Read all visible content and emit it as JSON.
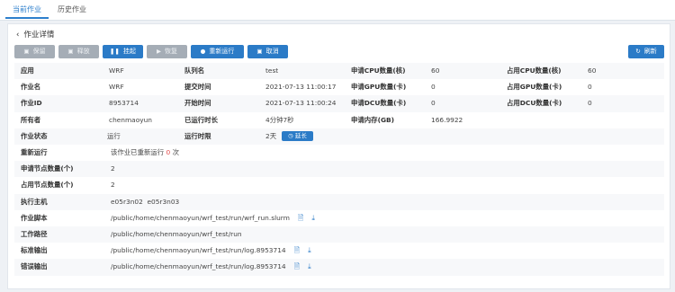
{
  "tabs": [
    {
      "label": "当前作业",
      "active": true
    },
    {
      "label": "历史作业",
      "active": false
    }
  ],
  "header": {
    "back_label": "作业详情"
  },
  "toolbar": {
    "hold": "保留",
    "release": "释放",
    "suspend": "挂起",
    "resume": "恢复",
    "rerun": "重新运行",
    "cancel": "取消",
    "refresh": "刷新"
  },
  "detail": {
    "app_label": "应用",
    "app": "WRF",
    "queue_label": "队列名",
    "queue": "test",
    "req_cpu_label": "申请CPU数量(核)",
    "req_cpu": "60",
    "used_cpu_label": "占用CPU数量(核)",
    "used_cpu": "60",
    "job_name_label": "作业名",
    "job_name": "WRF",
    "submit_time_label": "提交时间",
    "submit_time": "2021-07-13 11:00:17",
    "req_gpu_label": "申请GPU数量(卡)",
    "req_gpu": "0",
    "used_gpu_label": "占用GPU数量(卡)",
    "used_gpu": "0",
    "job_id_label": "作业ID",
    "job_id": "8953714",
    "start_time_label": "开始时间",
    "start_time": "2021-07-13 11:00:24",
    "req_dcu_label": "申请DCU数量(卡)",
    "req_dcu": "0",
    "used_dcu_label": "占用DCU数量(卡)",
    "used_dcu": "0",
    "owner_label": "所有者",
    "owner": "chenmaoyun",
    "elapsed_label": "已运行时长",
    "elapsed": "4分钟7秒",
    "req_mem_label": "申请内存(GB)",
    "req_mem": "166.9922",
    "status_label": "作业状态",
    "status": "运行",
    "limit_label": "运行时限",
    "limit": "2天",
    "extend_label": "延长",
    "rerun_label": "重新运行",
    "rerun_prefix": "该作业已重新运行",
    "rerun_count": "0",
    "rerun_suffix": "次",
    "req_nodes_label": "申请节点数量(个)",
    "req_nodes": "2",
    "used_nodes_label": "占用节点数量(个)",
    "used_nodes": "2",
    "hosts_label": "执行主机",
    "hosts": "e05r3n02  e05r3n03",
    "script_label": "作业脚本",
    "script": "/public/home/chenmaoyun/wrf_test/run/wrf_run.slurm",
    "workdir_label": "工作路径",
    "workdir": "/public/home/chenmaoyun/wrf_test/run",
    "stdout_label": "标准输出",
    "stdout": "/public/home/chenmaoyun/wrf_test/run/log.8953714",
    "stderr_label": "错误输出",
    "stderr": "/public/home/chenmaoyun/wrf_test/run/log.8953714"
  }
}
